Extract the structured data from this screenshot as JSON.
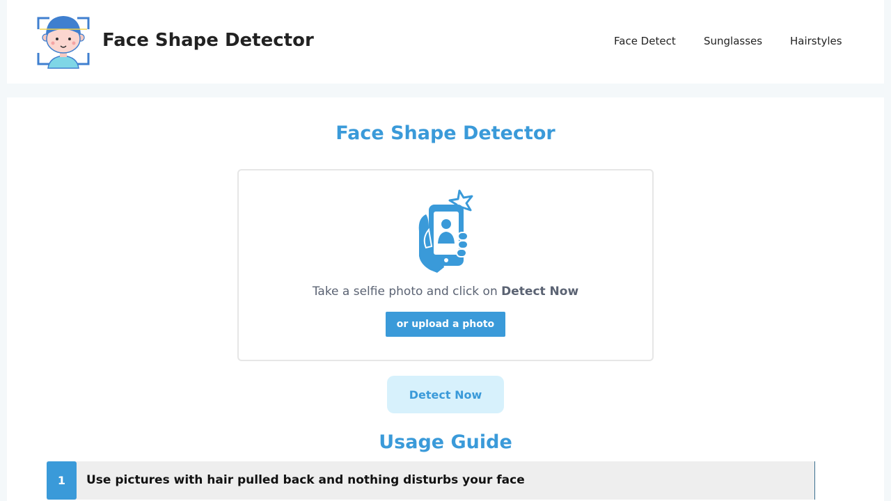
{
  "header": {
    "site_title": "Face Shape Detector",
    "logo_icon": "face-scan-icon",
    "nav": [
      {
        "label": "Face Detect"
      },
      {
        "label": "Sunglasses"
      },
      {
        "label": "Hairstyles"
      }
    ]
  },
  "main": {
    "title": "Face Shape Detector",
    "upload": {
      "icon": "selfie-phone-icon",
      "instruction_prefix": "Take a selfie photo and click on ",
      "instruction_bold": "Detect Now",
      "upload_button": "or upload a photo"
    },
    "detect_button": "Detect Now",
    "guide": {
      "title": "Usage Guide",
      "items": [
        {
          "number": "1",
          "text": "Use pictures with hair pulled back and nothing disturbs your face"
        }
      ]
    }
  },
  "colors": {
    "accent": "#3a9ad9",
    "detect_button_bg": "#d7f1fc",
    "page_bg": "#f4f8fa"
  }
}
